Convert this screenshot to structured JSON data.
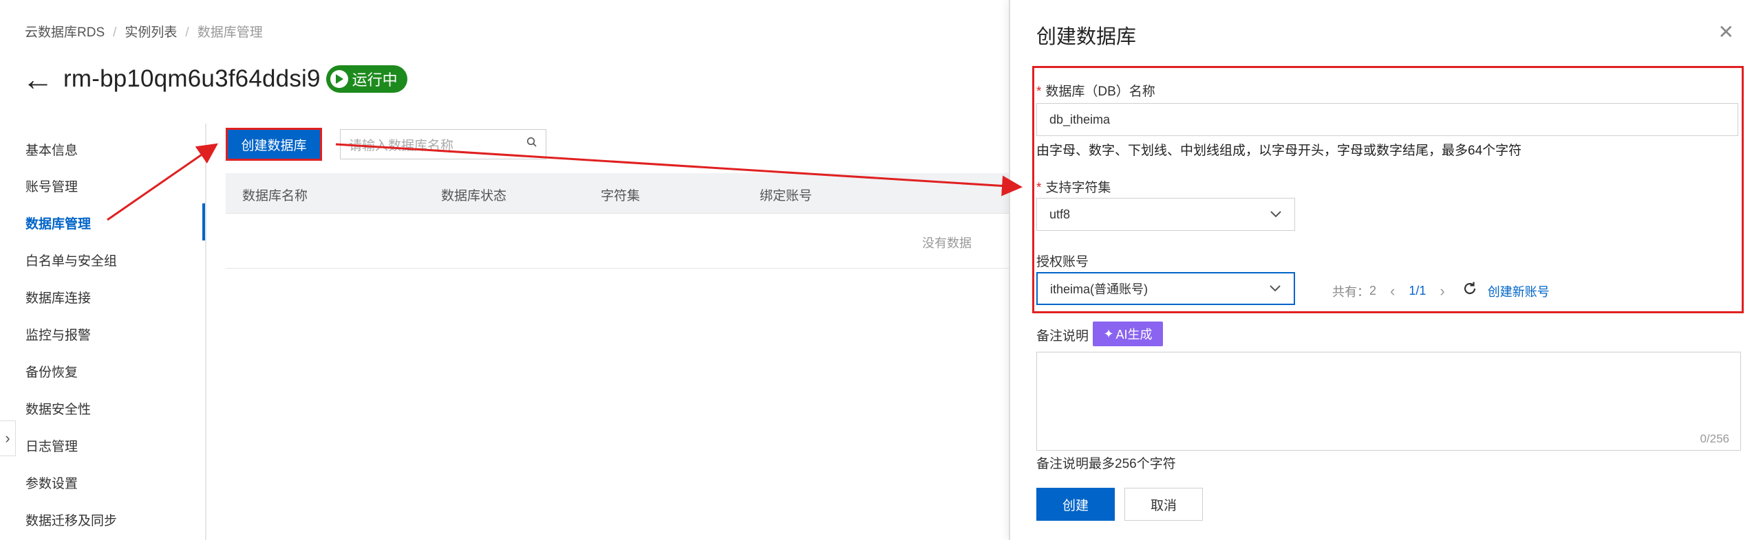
{
  "breadcrumb": [
    "云数据库RDS",
    "实例列表",
    "数据库管理"
  ],
  "instance": {
    "title": "rm-bp10qm6u3f64ddsi9",
    "status": "运行中"
  },
  "sidebar": {
    "items": [
      {
        "label": "基本信息"
      },
      {
        "label": "账号管理"
      },
      {
        "label": "数据库管理"
      },
      {
        "label": "白名单与安全组"
      },
      {
        "label": "数据库连接"
      },
      {
        "label": "监控与报警"
      },
      {
        "label": "备份恢复"
      },
      {
        "label": "数据安全性"
      },
      {
        "label": "日志管理"
      },
      {
        "label": "参数设置"
      },
      {
        "label": "数据迁移及同步"
      }
    ],
    "active_index": 2
  },
  "toolbar": {
    "create_label": "创建数据库",
    "search_placeholder": "请输入数据库名称"
  },
  "table": {
    "columns": [
      "数据库名称",
      "数据库状态",
      "字符集",
      "绑定账号"
    ],
    "empty_text": "没有数据"
  },
  "drawer": {
    "title": "创建数据库",
    "db_name": {
      "label": "数据库（DB）名称",
      "value": "db_itheima",
      "hint": "由字母、数字、下划线、中划线组成，以字母开头，字母或数字结尾，最多64个字符"
    },
    "charset": {
      "label": "支持字符集",
      "value": "utf8"
    },
    "account": {
      "label": "授权账号",
      "value": "itheima(普通账号)",
      "total_label": "共有：",
      "total": "2",
      "page": "1/1",
      "create_link": "创建新账号"
    },
    "remark": {
      "label": "备注说明",
      "ai_label": "AI生成",
      "counter": "0/256",
      "hint": "备注说明最多256个字符"
    },
    "buttons": {
      "create": "创建",
      "cancel": "取消"
    }
  },
  "colors": {
    "primary": "#0064c8",
    "annotation": "#e02020",
    "status_green": "#1d8a1d",
    "ai_purple": "#8a63f0"
  }
}
